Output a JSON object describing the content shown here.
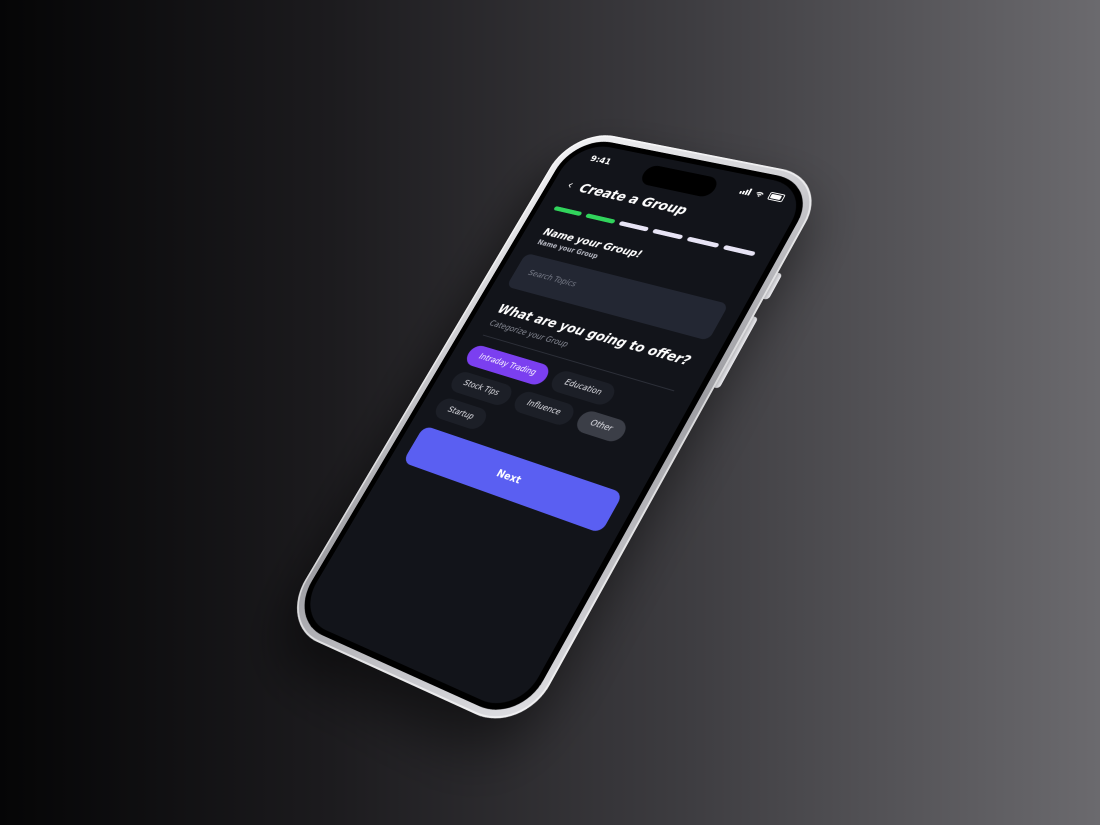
{
  "status_bar": {
    "time": "9:41"
  },
  "header": {
    "title": "Create a Group",
    "back_icon": "chevron-left-icon"
  },
  "progress": {
    "total_steps": 6,
    "completed_steps": 2,
    "completed_color": "#31d45c",
    "pending_color": "#e7e4f5"
  },
  "name_section": {
    "title": "Name your Group!",
    "subtitle": "Name your Group",
    "search_placeholder": "Search Topics",
    "search_value": ""
  },
  "offer_section": {
    "title": "What are you going to offer?",
    "subtitle": "Categorize your Group",
    "chips": [
      {
        "label": "Intraday Trading",
        "state": "selected"
      },
      {
        "label": "Education",
        "state": "default"
      },
      {
        "label": "Stock Tips",
        "state": "default"
      },
      {
        "label": "Influence",
        "state": "default"
      },
      {
        "label": "Other",
        "state": "muted"
      },
      {
        "label": "Startup",
        "state": "default"
      }
    ]
  },
  "actions": {
    "next_label": "Next"
  },
  "colors": {
    "accent": "#5a5ff2",
    "selected_chip": "#7b3ff0",
    "screen_bg": "#12141a"
  }
}
